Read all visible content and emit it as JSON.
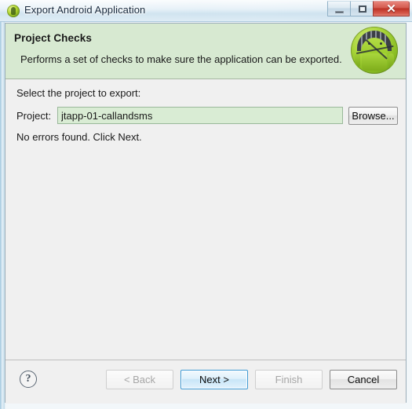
{
  "window": {
    "title": "Export Android Application",
    "app_icon": "android-app-icon",
    "controls": {
      "minimize": "minimize-icon",
      "maximize": "maximize-icon",
      "close": "✕"
    }
  },
  "header": {
    "title": "Project Checks",
    "description": "Performs a set of checks to make sure the application can be exported.",
    "banner_icon": "android-robot-icon",
    "background_color": "#d7e9d1"
  },
  "body": {
    "select_label": "Select the project to export:",
    "project_label": "Project:",
    "project_value": "jtapp-01-callandsms",
    "project_placeholder": "",
    "project_field_color": "#d9ecd4",
    "browse_label": "Browse...",
    "status_message": "No errors found. Click Next."
  },
  "footer": {
    "help_icon": "question-mark-icon",
    "buttons": [
      {
        "label": "< Back",
        "state": "disabled"
      },
      {
        "label": "Next >",
        "state": "default"
      },
      {
        "label": "Finish",
        "state": "disabled"
      },
      {
        "label": "Cancel",
        "state": "enabled"
      }
    ]
  }
}
